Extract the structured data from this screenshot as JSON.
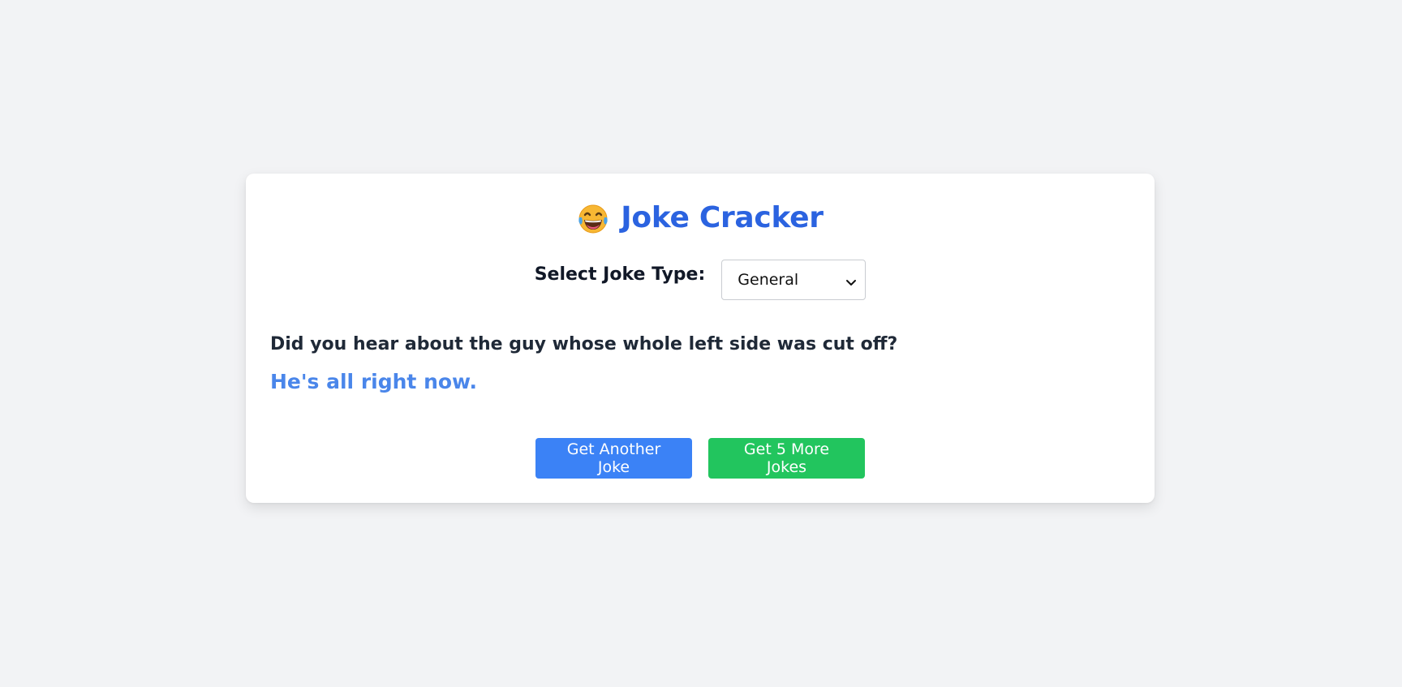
{
  "app": {
    "title": "Joke Cracker",
    "emoji_icon": "laughing-tears-emoji"
  },
  "joke_type": {
    "label": "Select Joke Type:",
    "selected": "General"
  },
  "joke": {
    "setup": "Did you hear about the guy whose whole left side was cut off?",
    "punchline": "He's all right now."
  },
  "actions": {
    "another_label": "Get Another Joke",
    "more_label": "Get 5 More Jokes"
  },
  "colors": {
    "title": "#2b63e0",
    "punchline": "#4a86ea",
    "button_blue": "#3b82f6",
    "button_green": "#22c55e",
    "background": "#f2f3f5"
  }
}
